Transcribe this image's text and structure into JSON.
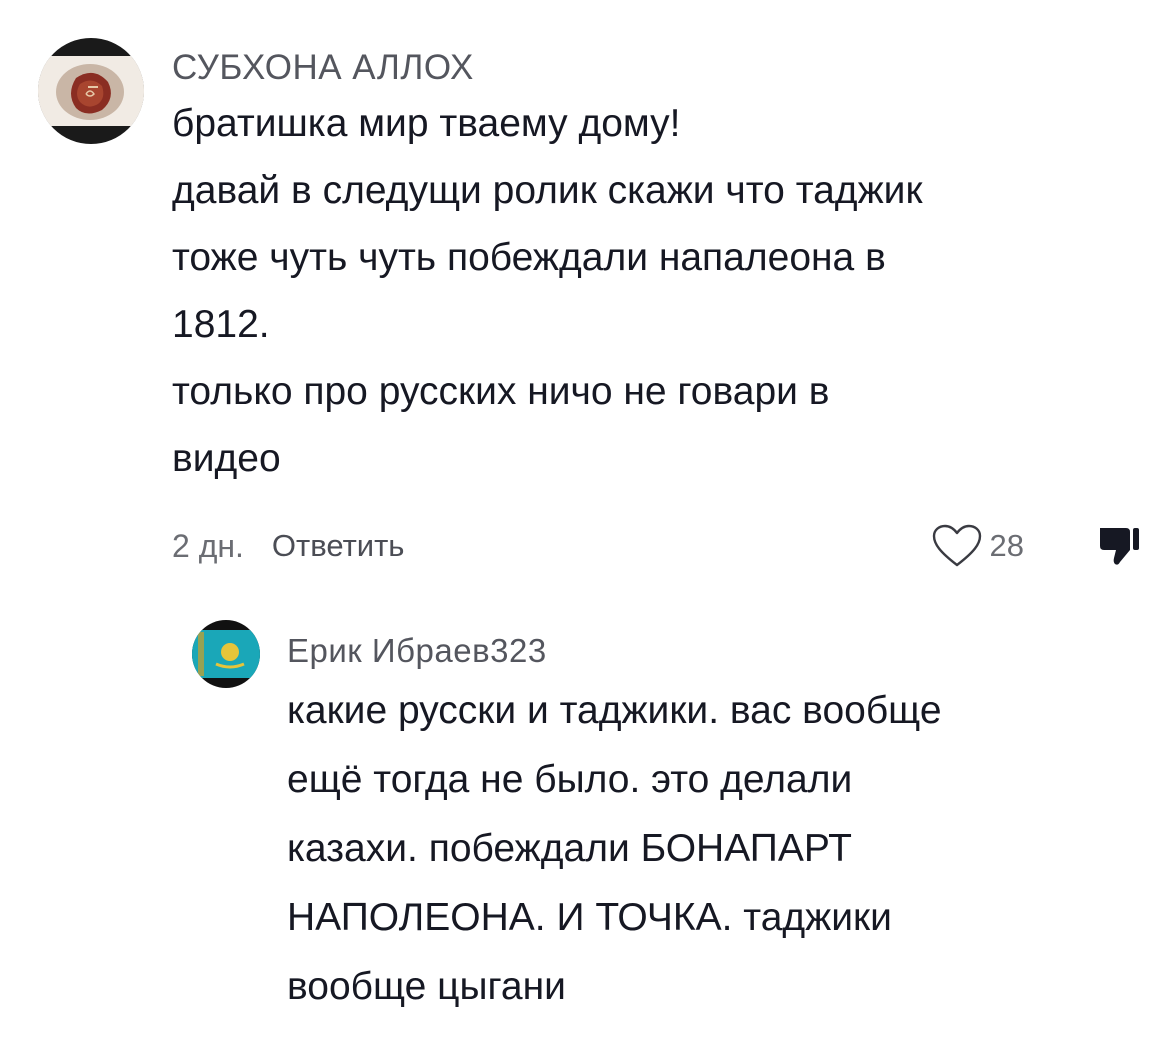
{
  "comments": [
    {
      "username": "СУБХОНА АЛЛОХ",
      "text": "братишка мир тваему дому!\nдавай в следущи ролик скажи что таджик\nтоже чуть чуть побеждали напалеона в\n1812.\nтолько про русских ничо не говари в\nвидео",
      "date": "2 дн.",
      "reply_label": "Ответить",
      "likes": "28",
      "avatar_icon": "avatar-photo-icon"
    },
    {
      "username": "Ерик Ибраев323",
      "text": "какие русски и таджики. вас вообще\nещё тогда не было. это делали\nказахи. побеждали БОНАПАРТ\nНАПОЛЕОНА. И ТОЧКА. таджики\nвообще цыгани",
      "avatar_icon": "avatar-kazakhstan-flag-icon"
    }
  ],
  "icons": {
    "like": "heart-outline-icon",
    "dislike": "thumbs-down-icon"
  },
  "colors": {
    "text": "#161823",
    "username": "#54565e",
    "meta": "#6b6d73",
    "reply": "#4b4d55"
  }
}
